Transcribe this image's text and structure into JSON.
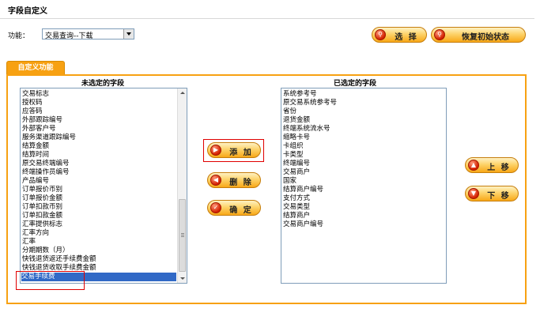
{
  "header": {
    "title": "字段自定义"
  },
  "function_row": {
    "label": "功能：",
    "selected_value": "交易查询--下载",
    "select_button_label": "选 择",
    "reset_button_label": "恢复初始状态"
  },
  "tab": {
    "label": "自定义功能"
  },
  "unselected": {
    "heading": "未选定的字段",
    "items": [
      "交易标志",
      "授权码",
      "应答码",
      "外部跟踪编号",
      "外部客户号",
      "服务渠道跟踪编号",
      "结算金额",
      "结算时间",
      "原交易终端编号",
      "终端操作员编号",
      "产品编号",
      "订单报价币别",
      "订单报价金额",
      "订单扣款币别",
      "订单扣款金额",
      "汇率提供标志",
      "汇率方向",
      "汇率",
      "分期期数（月）",
      "快钱退货返还手续费金额",
      "快钱退货收取手续费金额",
      "交易手续费"
    ],
    "selected_item": "交易手续费"
  },
  "selected": {
    "heading": "已选定的字段",
    "items": [
      "系统参考号",
      "原交易系统参考号",
      "省份",
      "退货金额",
      "终端系统流水号",
      "缩略卡号",
      "卡组织",
      "卡类型",
      "终端编号",
      "交易商户",
      "国家",
      "结算商户编号",
      "支付方式",
      "交易类型",
      "结算商户",
      "交易商户编号"
    ]
  },
  "actions": {
    "add": "添 加",
    "delete": "删 除",
    "confirm": "确 定"
  },
  "order": {
    "up": "上 移",
    "down": "下 移"
  },
  "colors": {
    "accent": "#f7a112",
    "selection": "#3169c6",
    "highlight": "#e00000"
  }
}
